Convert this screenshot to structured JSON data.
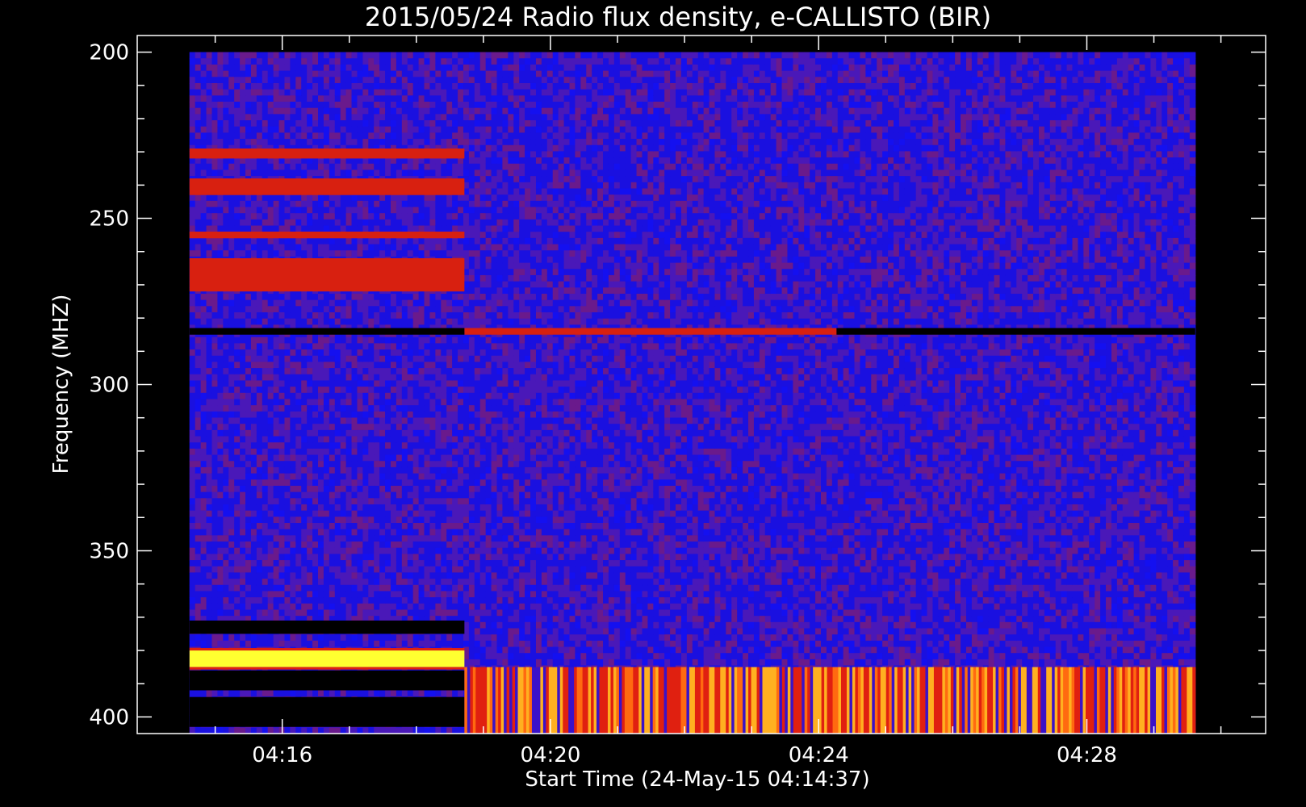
{
  "chart_data": {
    "type": "heatmap",
    "title": "2015/05/24  Radio flux density, e-CALLISTO (BIR)",
    "xlabel": "Start Time (24-May-15 04:14:37)",
    "ylabel": "Frequency (MHZ)",
    "x_unit": "minutes after 04:14:37",
    "ylim": [
      405,
      195
    ],
    "xlim": [
      -0.78,
      16.05
    ],
    "data_x_range": [
      0.0,
      15.0
    ],
    "data_y_range": [
      200,
      405
    ],
    "y_ticks": [
      {
        "value": 200,
        "label": "200"
      },
      {
        "value": 250,
        "label": "250"
      },
      {
        "value": 300,
        "label": "300"
      },
      {
        "value": 350,
        "label": "350"
      },
      {
        "value": 400,
        "label": "400"
      }
    ],
    "y_minor_step": 10,
    "x_ticks": [
      {
        "value": 1.383,
        "label": "04:16"
      },
      {
        "value": 5.383,
        "label": "04:20"
      },
      {
        "value": 9.383,
        "label": "04:24"
      },
      {
        "value": 13.383,
        "label": "04:28"
      }
    ],
    "x_minor_step": 1,
    "colormap": [
      "#000000",
      "#0000ff",
      "#ff0000",
      "#ffff00"
    ],
    "background_level": "blue",
    "features": [
      {
        "name": "dropout",
        "x": [
          0.0,
          4.1
        ],
        "y": [
          371,
          375
        ],
        "level": "black"
      },
      {
        "name": "band",
        "x": [
          0.0,
          4.1
        ],
        "y": [
          380,
          385
        ],
        "level": "yellow"
      },
      {
        "name": "dropout",
        "x": [
          0.0,
          4.1
        ],
        "y": [
          386,
          392
        ],
        "level": "black"
      },
      {
        "name": "dropout",
        "x": [
          0.0,
          4.1
        ],
        "y": [
          394,
          403
        ],
        "level": "black"
      },
      {
        "name": "band",
        "x": [
          0.0,
          4.1
        ],
        "y": [
          238,
          243
        ],
        "level": "red"
      },
      {
        "name": "band",
        "x": [
          0.0,
          4.1
        ],
        "y": [
          229,
          232
        ],
        "level": "red"
      },
      {
        "name": "band",
        "x": [
          0.0,
          4.1
        ],
        "y": [
          262,
          272
        ],
        "level": "red"
      },
      {
        "name": "band",
        "x": [
          0.0,
          4.1
        ],
        "y": [
          254,
          256
        ],
        "level": "red"
      },
      {
        "name": "band",
        "x": [
          4.1,
          9.65
        ],
        "y": [
          283,
          285
        ],
        "level": "red"
      },
      {
        "name": "dropout",
        "x": [
          9.65,
          15.0
        ],
        "y": [
          283,
          285
        ],
        "level": "black"
      },
      {
        "name": "dropout",
        "x": [
          0.0,
          4.1
        ],
        "y": [
          283,
          285
        ],
        "level": "black"
      },
      {
        "name": "band",
        "x": [
          4.1,
          15.0
        ],
        "y": [
          385,
          405
        ],
        "level": "red-yellow"
      }
    ]
  }
}
